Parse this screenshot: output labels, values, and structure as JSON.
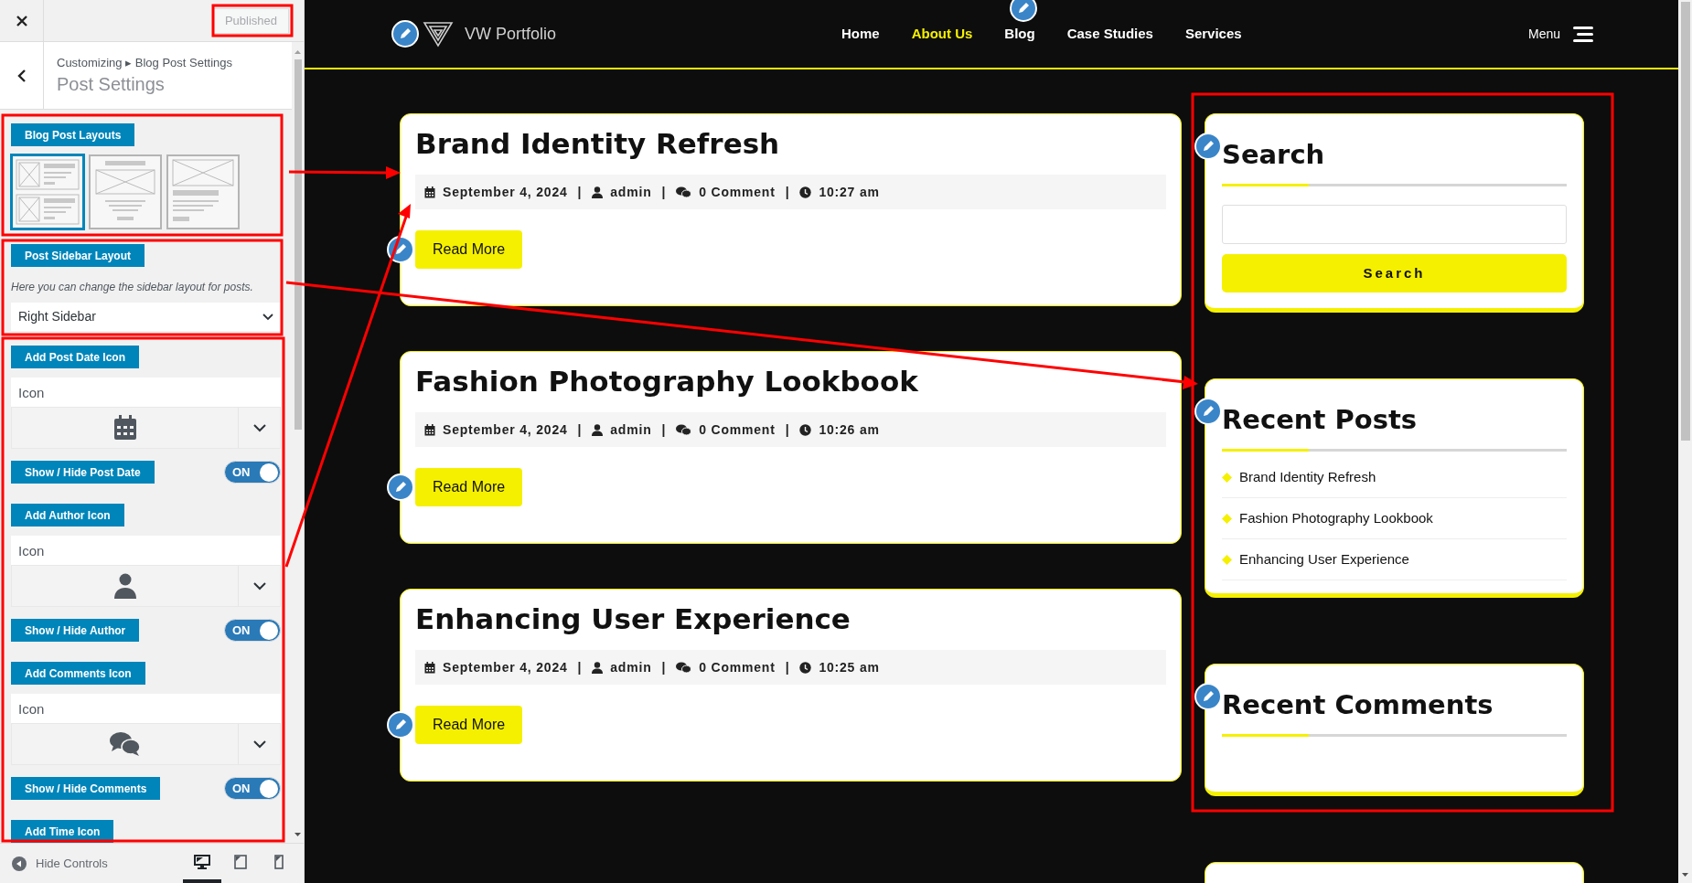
{
  "customizer": {
    "publish_button": "Published",
    "breadcrumb": "Customizing ▸ Blog Post Settings",
    "title": "Post Settings",
    "controls": [
      {
        "kind": "heading",
        "label": "Blog Post Layouts"
      },
      {
        "kind": "layouts",
        "options": [
          {
            "kind": "list",
            "selected": true
          },
          {
            "kind": "centered",
            "selected": false
          },
          {
            "kind": "wide",
            "selected": false
          }
        ]
      },
      {
        "kind": "heading",
        "label": "Post Sidebar Layout"
      },
      {
        "kind": "note",
        "text": "Here you can change the sidebar layout for posts."
      },
      {
        "kind": "select",
        "value": "Right Sidebar"
      },
      {
        "kind": "heading",
        "label": "Add Post Date Icon"
      },
      {
        "kind": "icon_picker",
        "placeholder": "Icon"
      },
      {
        "kind": "toggle",
        "label": "Show / Hide Post Date",
        "on": true,
        "state_text": "ON"
      },
      {
        "kind": "heading",
        "label": "Add Author Icon"
      },
      {
        "kind": "icon_picker",
        "placeholder": "Icon"
      },
      {
        "kind": "toggle",
        "label": "Show / Hide Author",
        "on": true,
        "state_text": "ON"
      },
      {
        "kind": "heading",
        "label": "Add Comments Icon"
      },
      {
        "kind": "icon_picker",
        "placeholder": "Icon"
      },
      {
        "kind": "toggle",
        "label": "Show / Hide Comments",
        "on": true,
        "state_text": "ON"
      },
      {
        "kind": "heading",
        "label": "Add Time Icon"
      }
    ],
    "hide_controls": "Hide Controls",
    "devices": [
      {
        "selected": true
      },
      {
        "selected": false
      },
      {
        "selected": false
      }
    ]
  },
  "site": {
    "logo_text": "VW Portfolio",
    "nav": [
      {
        "label": "Home",
        "selected": false
      },
      {
        "label": "About Us",
        "selected": true
      },
      {
        "label": "Blog",
        "selected": false
      },
      {
        "label": "Case Studies",
        "selected": false
      },
      {
        "label": "Services",
        "selected": false
      }
    ],
    "menu_label": "Menu",
    "posts": [
      {
        "title": "Brand Identity Refresh",
        "date": "September 4, 2024",
        "author": "admin",
        "comments": "0 Comment",
        "time": "10:27 am",
        "separator": "|",
        "button": "Read More"
      },
      {
        "title": "Fashion Photography Lookbook",
        "date": "September 4, 2024",
        "author": "admin",
        "comments": "0 Comment",
        "time": "10:26 am",
        "separator": "|",
        "button": "Read More"
      },
      {
        "title": "Enhancing User Experience",
        "date": "September 4, 2024",
        "author": "admin",
        "comments": "0 Comment",
        "time": "10:25 am",
        "separator": "|",
        "button": "Read More"
      }
    ],
    "widgets": [
      {
        "kind": "search",
        "title": "Search",
        "button": "Search"
      },
      {
        "kind": "list",
        "title": "Recent Posts",
        "items": [
          "Brand Identity Refresh",
          "Fashion Photography Lookbook",
          "Enhancing User Experience"
        ]
      },
      {
        "kind": "empty",
        "title": "Recent Comments"
      }
    ]
  }
}
